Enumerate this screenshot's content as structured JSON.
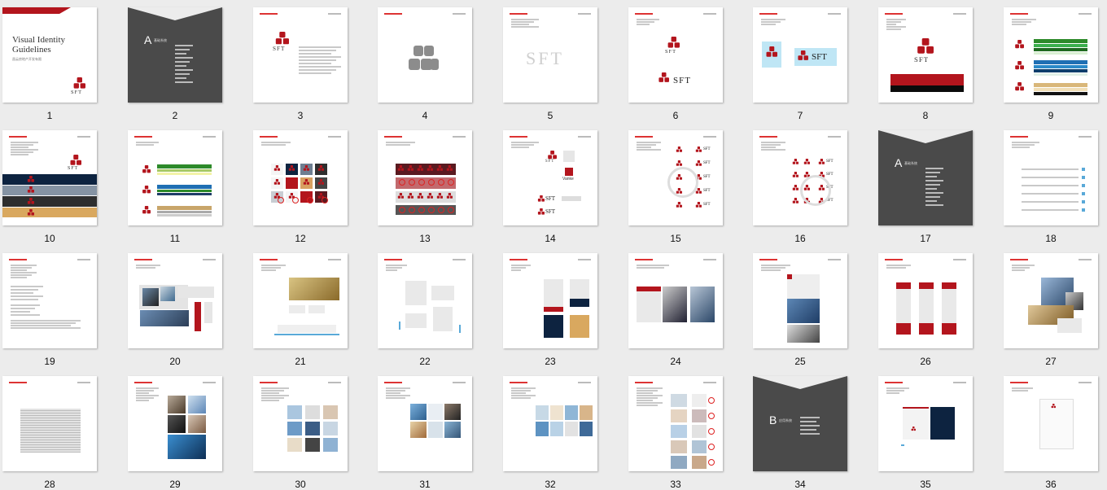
{
  "cover": {
    "title": "Visual Identity Guidelines",
    "subtitle": "昌云房地产开发有限",
    "logo_text": "SFT"
  },
  "section_a": {
    "letter": "A",
    "label": "基础系统"
  },
  "section_b": {
    "letter": "B",
    "label": "应用系统"
  },
  "vanke_label": "Vanke",
  "pages": [
    "1",
    "2",
    "3",
    "4",
    "5",
    "6",
    "7",
    "8",
    "9",
    "10",
    "11",
    "12",
    "13",
    "14",
    "15",
    "16",
    "17",
    "18",
    "19",
    "20",
    "21",
    "22",
    "23",
    "24",
    "25",
    "26",
    "27",
    "28",
    "29",
    "30",
    "31",
    "32",
    "33",
    "34",
    "35",
    "36"
  ],
  "colors": {
    "brand_red": "#b3151d",
    "dark_gray": "#4a4a4a",
    "navy": "#0d2340",
    "green": "#2d8a2a",
    "blue": "#1f6fb3",
    "gold": "#d9b77a",
    "page_bg": "#ececec"
  }
}
